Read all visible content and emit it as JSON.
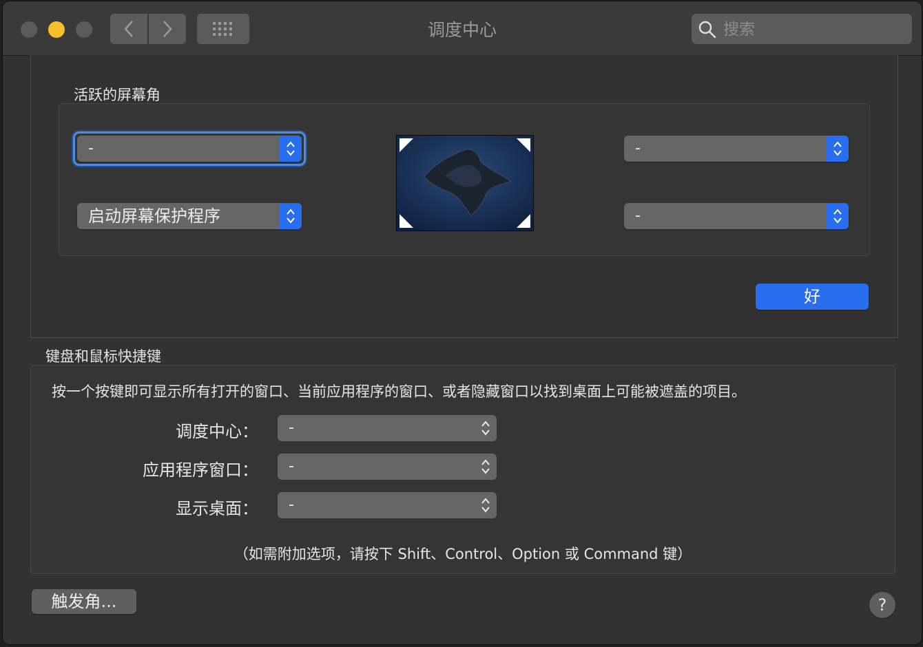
{
  "window": {
    "title": "调度中心",
    "search_placeholder": "搜索"
  },
  "hot_corners_sheet": {
    "label": "活跃的屏幕角",
    "top_left": "-",
    "bottom_left": "启动屏幕保护程序",
    "top_right": "-",
    "bottom_right": "-",
    "ok_label": "好"
  },
  "keyboard": {
    "title": "键盘和鼠标快捷键",
    "description": "按一个按键即可显示所有打开的窗口、当前应用程序的窗口、或者隐藏窗口以找到桌面上可能被遮盖的项目。",
    "rows": [
      {
        "label": "调度中心：",
        "value": "-"
      },
      {
        "label": "应用程序窗口：",
        "value": "-"
      },
      {
        "label": "显示桌面：",
        "value": "-"
      }
    ],
    "note": "（如需附加选项，请按下 Shift、Control、Option 或 Command 键）"
  },
  "footer": {
    "hot_corners_button": "触发角...",
    "help_label": "?"
  },
  "colors": {
    "accent": "#2a6ef0",
    "window_bg": "#323232",
    "minimize": "#f5c02a"
  }
}
